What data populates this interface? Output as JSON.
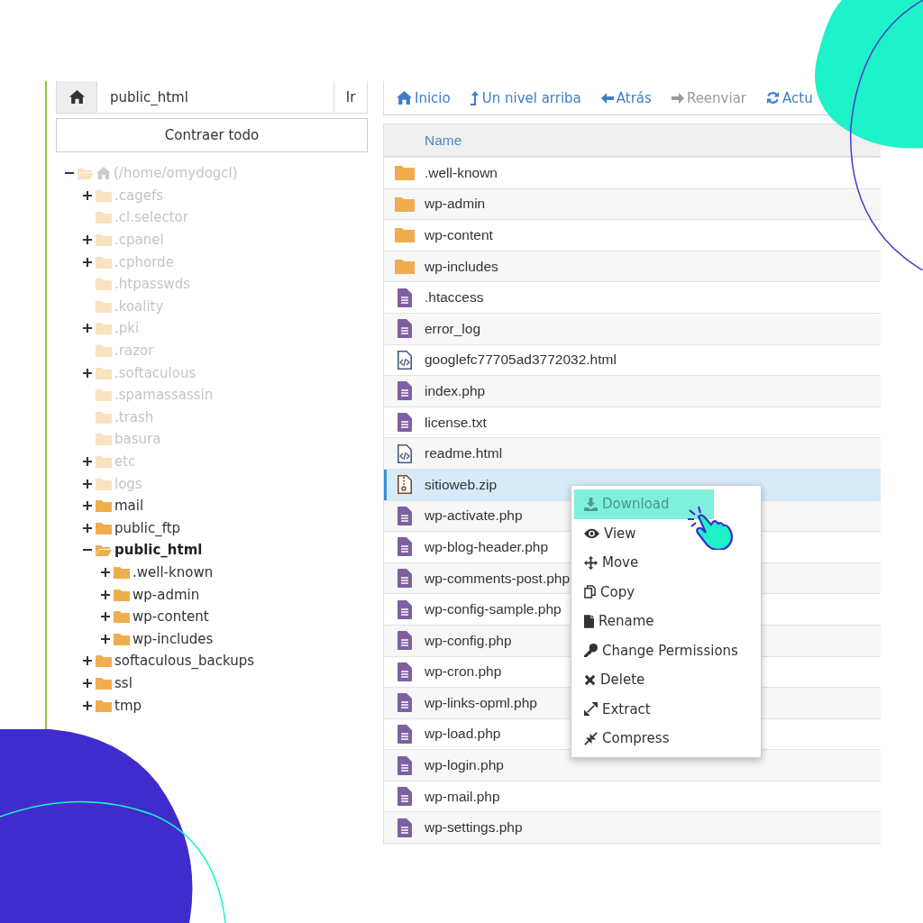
{
  "path_bar": {
    "value": "public_html",
    "go_button": "Ir"
  },
  "collapse_button": "Contraer todo",
  "tree": {
    "label": "(/home/omydogcl)",
    "root": true,
    "expandable": true,
    "expanded": true,
    "faded": true,
    "selected": false,
    "children": [
      {
        "label": ".cagefs",
        "expandable": true,
        "expanded": false,
        "faded": true,
        "selected": false
      },
      {
        "label": ".cl.selector",
        "expandable": false,
        "expanded": false,
        "faded": true,
        "selected": false
      },
      {
        "label": ".cpanel",
        "expandable": true,
        "expanded": false,
        "faded": true,
        "selected": false
      },
      {
        "label": ".cphorde",
        "expandable": true,
        "expanded": false,
        "faded": true,
        "selected": false
      },
      {
        "label": ".htpasswds",
        "expandable": false,
        "expanded": false,
        "faded": true,
        "selected": false
      },
      {
        "label": ".koality",
        "expandable": false,
        "expanded": false,
        "faded": true,
        "selected": false
      },
      {
        "label": ".pki",
        "expandable": true,
        "expanded": false,
        "faded": true,
        "selected": false
      },
      {
        "label": ".razor",
        "expandable": false,
        "expanded": false,
        "faded": true,
        "selected": false
      },
      {
        "label": ".softaculous",
        "expandable": true,
        "expanded": false,
        "faded": true,
        "selected": false
      },
      {
        "label": ".spamassassin",
        "expandable": false,
        "expanded": false,
        "faded": true,
        "selected": false
      },
      {
        "label": ".trash",
        "expandable": false,
        "expanded": false,
        "faded": true,
        "selected": false
      },
      {
        "label": "basura",
        "expandable": false,
        "expanded": false,
        "faded": true,
        "selected": false
      },
      {
        "label": "etc",
        "expandable": true,
        "expanded": false,
        "faded": true,
        "selected": false
      },
      {
        "label": "logs",
        "expandable": true,
        "expanded": false,
        "faded": true,
        "selected": false
      },
      {
        "label": "mail",
        "expandable": true,
        "expanded": false,
        "faded": false,
        "selected": false
      },
      {
        "label": "public_ftp",
        "expandable": true,
        "expanded": false,
        "faded": false,
        "selected": false
      },
      {
        "label": "public_html",
        "expandable": true,
        "expanded": true,
        "faded": false,
        "selected": true,
        "children": [
          {
            "label": ".well-known",
            "expandable": true,
            "expanded": false,
            "faded": false,
            "selected": false
          },
          {
            "label": "wp-admin",
            "expandable": true,
            "expanded": false,
            "faded": false,
            "selected": false
          },
          {
            "label": "wp-content",
            "expandable": true,
            "expanded": false,
            "faded": false,
            "selected": false
          },
          {
            "label": "wp-includes",
            "expandable": true,
            "expanded": false,
            "faded": false,
            "selected": false
          }
        ]
      },
      {
        "label": "softaculous_backups",
        "expandable": true,
        "expanded": false,
        "faded": false,
        "selected": false
      },
      {
        "label": "ssl",
        "expandable": true,
        "expanded": false,
        "faded": false,
        "selected": false
      },
      {
        "label": "tmp",
        "expandable": true,
        "expanded": false,
        "faded": false,
        "selected": false
      }
    ]
  },
  "toolbar": [
    {
      "kind": "home",
      "label": "Inicio",
      "disabled": false
    },
    {
      "kind": "up",
      "label": "Un nivel arriba",
      "disabled": false
    },
    {
      "kind": "back",
      "label": "Atrás",
      "disabled": false
    },
    {
      "kind": "forward",
      "label": "Reenviar",
      "disabled": true
    },
    {
      "kind": "reload",
      "label": "Actu",
      "disabled": false
    }
  ],
  "table": {
    "columns": [
      "Name"
    ],
    "rows": [
      {
        "kind": "folder",
        "name": ".well-known",
        "selected": false
      },
      {
        "kind": "folder",
        "name": "wp-admin",
        "selected": false
      },
      {
        "kind": "folder",
        "name": "wp-content",
        "selected": false
      },
      {
        "kind": "folder",
        "name": "wp-includes",
        "selected": false
      },
      {
        "kind": "text",
        "name": ".htaccess",
        "selected": false
      },
      {
        "kind": "text",
        "name": "error_log",
        "selected": false
      },
      {
        "kind": "code",
        "name": "googlefc77705ad3772032.html",
        "selected": false
      },
      {
        "kind": "text",
        "name": "index.php",
        "selected": false
      },
      {
        "kind": "text",
        "name": "license.txt",
        "selected": false
      },
      {
        "kind": "code",
        "name": "readme.html",
        "selected": false
      },
      {
        "kind": "zip",
        "name": "sitioweb.zip",
        "selected": true
      },
      {
        "kind": "text",
        "name": "wp-activate.php",
        "selected": false
      },
      {
        "kind": "text",
        "name": "wp-blog-header.php",
        "selected": false
      },
      {
        "kind": "text",
        "name": "wp-comments-post.php",
        "selected": false
      },
      {
        "kind": "text",
        "name": "wp-config-sample.php",
        "selected": false
      },
      {
        "kind": "text",
        "name": "wp-config.php",
        "selected": false
      },
      {
        "kind": "text",
        "name": "wp-cron.php",
        "selected": false
      },
      {
        "kind": "text",
        "name": "wp-links-opml.php",
        "selected": false
      },
      {
        "kind": "text",
        "name": "wp-load.php",
        "selected": false
      },
      {
        "kind": "text",
        "name": "wp-login.php",
        "selected": false
      },
      {
        "kind": "text",
        "name": "wp-mail.php",
        "selected": false
      },
      {
        "kind": "text",
        "name": "wp-settings.php",
        "selected": false
      }
    ]
  },
  "context_menu": [
    {
      "kind": "download",
      "label": "Download",
      "selected": true
    },
    {
      "kind": "view",
      "label": "View",
      "selected": false
    },
    {
      "kind": "move",
      "label": "Move",
      "selected": false
    },
    {
      "kind": "copy",
      "label": "Copy",
      "selected": false
    },
    {
      "kind": "rename",
      "label": "Rename",
      "selected": false
    },
    {
      "kind": "permissions",
      "label": "Change Permissions",
      "selected": false
    },
    {
      "kind": "delete",
      "label": "Delete",
      "selected": false
    },
    {
      "kind": "extract",
      "label": "Extract",
      "selected": false
    },
    {
      "kind": "compress",
      "label": "Compress",
      "selected": false
    }
  ]
}
